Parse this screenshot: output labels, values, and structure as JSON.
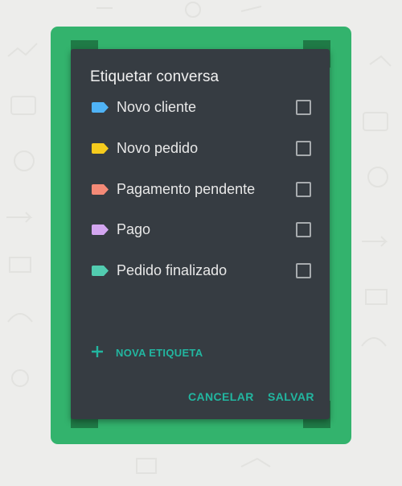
{
  "dialog": {
    "title": "Etiquetar conversa",
    "labels": [
      {
        "name": "Novo cliente",
        "color": "#4fb3f6",
        "checked": false
      },
      {
        "name": "Novo pedido",
        "color": "#f5cb1d",
        "checked": false
      },
      {
        "name": "Pagamento pendente",
        "color": "#f48a77",
        "checked": false
      },
      {
        "name": "Pago",
        "color": "#d3a6f0",
        "checked": false
      },
      {
        "name": "Pedido finalizado",
        "color": "#52ccb0",
        "checked": false
      }
    ],
    "new_label": "NOVA ETIQUETA",
    "cancel_label": "CANCELAR",
    "save_label": "SALVAR"
  },
  "colors": {
    "frame": "#33b36d",
    "dialog_bg": "#363c42",
    "accent": "#22b6a0"
  }
}
